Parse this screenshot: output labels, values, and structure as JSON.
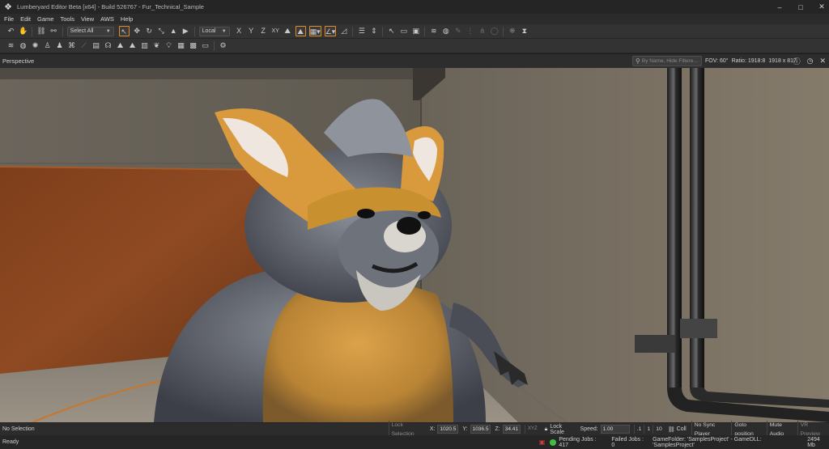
{
  "window": {
    "title": "Lumberyard Editor Beta [x64] - Build 526767 - Fur_Technical_Sample",
    "controls": [
      "–",
      "□",
      "✕"
    ]
  },
  "menu": [
    "File",
    "Edit",
    "Game",
    "Tools",
    "View",
    "AWS",
    "Help"
  ],
  "toolbar1": {
    "select_filter": "Select All",
    "coordinate_space": "Local",
    "axis_x": "X",
    "axis_y": "Y",
    "axis_z": "Z",
    "axis_xy": "XY"
  },
  "viewport": {
    "title": "Perspective",
    "search_placeholder": "By Name, Hide Filtere...",
    "fov": "FOV: 60°",
    "ratio": "Ratio: 1918:8",
    "resolution": "1918 x 817"
  },
  "status": {
    "selection": "No Selection",
    "lock_selection": "Lock Selection",
    "x_label": "X:",
    "x_value": "1020.5",
    "y_label": "Y:",
    "y_value": "1036.5",
    "z_label": "Z:",
    "z_value": "34.41",
    "xyz_label": "XYZ",
    "lock_scale": "Lock Scale",
    "speed_label": "Speed:",
    "speed_value": "1.00",
    "speed_presets": [
      ".1",
      "1",
      "10"
    ],
    "coll": "Coll",
    "no_sync_player": "No Sync Player",
    "goto_position": "Goto position",
    "mute_audio": "Mute Audio",
    "vr_preview": "VR Preview",
    "ready": "Ready",
    "pending_jobs": "Pending Jobs : 417",
    "failed_jobs": "Failed Jobs : 0",
    "game_folder": "GameFolder: 'SamplesProject' - GameDLL: 'SamplesProject'",
    "memory": "2494 Mb"
  },
  "colors": {
    "accent": "#e08a2c",
    "status_ok": "#3fbf3f",
    "status_error": "#d03a3a"
  }
}
